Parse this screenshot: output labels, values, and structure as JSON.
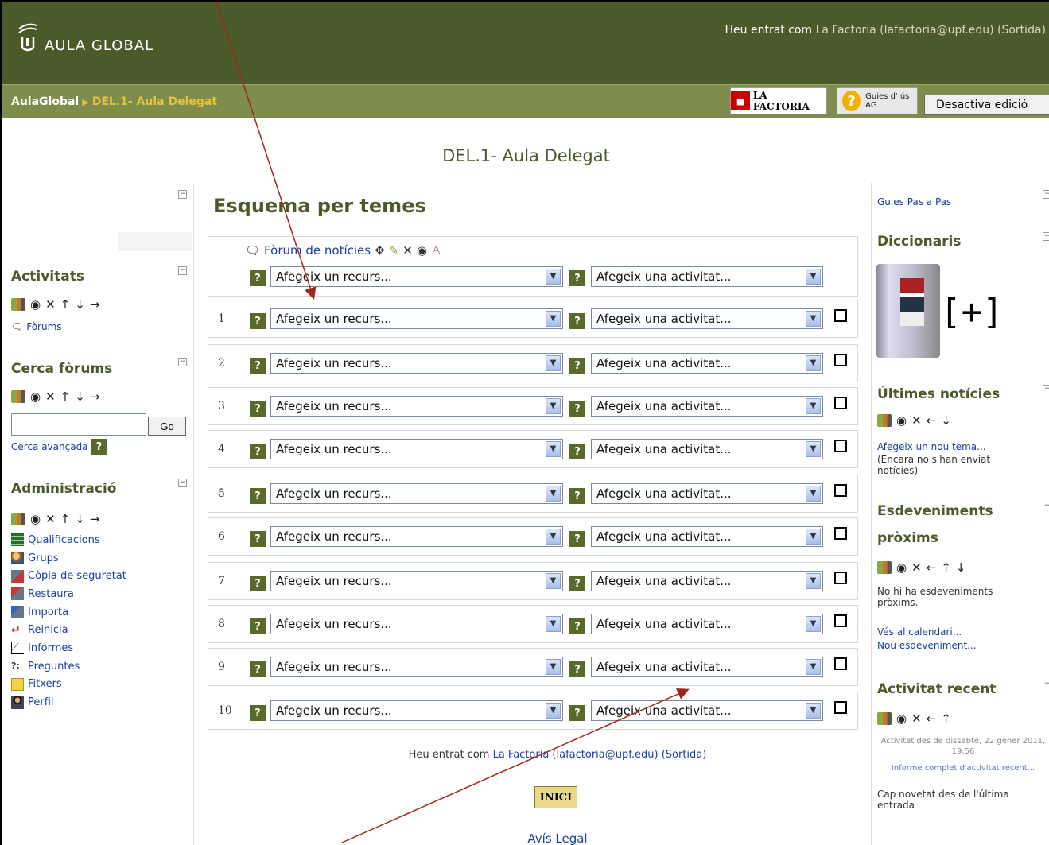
{
  "header": {
    "logo_text": "AULA GLOBAL",
    "login_prefix": "Heu entrat com ",
    "login_name": "La Factoria (lafactoria@upf.edu)",
    "logout": "(Sortida)"
  },
  "navbar": {
    "crumb_home": "AulaGlobal",
    "crumb_current": "DEL.1- Aula Delegat",
    "lafactoria_label": "LA FACTORIA",
    "guies_label": "Guies d' ús AG",
    "edit_button": "Desactiva edició"
  },
  "course_title": "DEL.1- Aula Delegat",
  "left": {
    "activitats": {
      "title": "Activitats",
      "forums": "Fòrums"
    },
    "cerca": {
      "title": "Cerca fòrums",
      "go": "Go",
      "advanced": "Cerca avançada"
    },
    "admin": {
      "title": "Administració",
      "items": [
        "Qualificacions",
        "Grups",
        "Còpia de seguretat",
        "Restaura",
        "Importa",
        "Reinicia",
        "Informes",
        "Preguntes",
        "Fitxers",
        "Perfil"
      ]
    }
  },
  "main": {
    "heading": "Esquema per temes",
    "news_forum": "Fòrum de notícies",
    "resource_placeholder": "Afegeix un recurs...",
    "activity_placeholder": "Afegeix una activitat...",
    "sections": [
      "1",
      "2",
      "3",
      "4",
      "5",
      "6",
      "7",
      "8",
      "9",
      "10"
    ],
    "footer_prefix": "Heu entrat com ",
    "footer_name": "La Factoria (lafactoria@upf.edu)",
    "footer_logout": "(Sortida)",
    "home_button": "INICI",
    "legal": "Avís Legal"
  },
  "right": {
    "guies_link": "Guies Pas a Pas",
    "dicc_title": "Diccionaris",
    "dicc_plus": "[+]",
    "news_title": "Últimes notícies",
    "news_add": "Afegeix un nou tema...",
    "news_empty": "(Encara no s'han enviat notícies)",
    "events_title_1": "Esdeveniments",
    "events_title_2": "pròxims",
    "events_empty": "No hi ha esdeveniments pròxims.",
    "events_calendar": "Vés al calendari...",
    "events_new": "Nou esdeveniment...",
    "recent_title": "Activitat recent",
    "recent_since": "Activitat des de dissabte, 22 gener 2011, 19:56",
    "recent_report": "Informe complet d'activitat recent...",
    "recent_none": "Cap novetat des de l'última entrada"
  },
  "colors": {
    "header": "#4b5a2a",
    "navbar": "#7e8c4e",
    "crumb_current": "#e8c33a",
    "annotation_arrow": "#a0281a"
  }
}
